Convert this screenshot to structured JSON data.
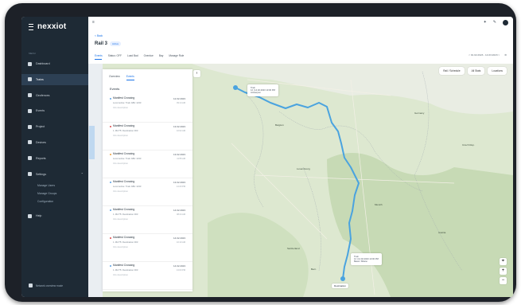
{
  "app": {
    "brand": "nexxiot"
  },
  "sidebar": {
    "section_label": "MENU",
    "items": [
      {
        "label": "Dashboard",
        "icon": "dashboard-icon"
      },
      {
        "label": "Trains",
        "icon": "train-icon"
      },
      {
        "label": "Geofences",
        "icon": "geofence-icon"
      },
      {
        "label": "Events",
        "icon": "events-icon"
      },
      {
        "label": "Project",
        "icon": "project-icon"
      },
      {
        "label": "Devices",
        "icon": "devices-icon"
      },
      {
        "label": "Reports",
        "icon": "reports-icon"
      },
      {
        "label": "Settings",
        "icon": "settings-icon"
      }
    ],
    "sub_items": [
      "Manage Users",
      "Manage Groups",
      "Configuration"
    ],
    "help_label": "Help",
    "footer": "Network overview mode"
  },
  "header": {
    "crumb": "< Back",
    "title": "Rail 3",
    "badge": "Active"
  },
  "filters": {
    "tabs": [
      "Events",
      "Status: OFF",
      "Load Bad",
      "Overdue",
      "Bay",
      "Manage Rule"
    ],
    "right_date_a": "< 01.02.2023 - 14.03.2023 >"
  },
  "map": {
    "controls": [
      "Rail / Schedule",
      "All Stats",
      "Locations"
    ],
    "start_label": "Train\n12 | 14.02.2023 13:00 PM\nAntwerpen",
    "end_label": "Train\n12 | 14.02.2023 13:00 PM\nBasel / Milano",
    "end_marker": "Destination",
    "cities": [
      "Belgium",
      "Germany",
      "Luxembourg",
      "Munich",
      "Czech Rep.",
      "Switzerland",
      "Austria",
      "Bern"
    ]
  },
  "panel": {
    "tabs": [
      "Overview",
      "Events"
    ],
    "heading": "Events",
    "events": [
      {
        "title": "Manifest Crossing",
        "sub": "Locomotive: Train ABC 1233",
        "meta": "Info description",
        "time": "12.02.2023",
        "time_sub": "09:14 AM",
        "dot": "blue"
      },
      {
        "title": "Manifest Crossing",
        "sub": "1 -Bz/75: Destination 003",
        "meta": "Info description",
        "time": "13.02.2023",
        "time_sub": "10:02 AM",
        "dot": "red"
      },
      {
        "title": "Manifest Crossing",
        "sub": "Locomotive: Train ABC 1233",
        "meta": "Info description",
        "time": "13.02.2023",
        "time_sub": "11:55 AM",
        "dot": "orange"
      },
      {
        "title": "Manifest Crossing",
        "sub": "Locomotive: Train ABC 1233",
        "meta": "Info description",
        "time": "13.02.2023",
        "time_sub": "14:20 PM",
        "dot": "blue"
      },
      {
        "title": "Manifest Crossing",
        "sub": "1 -Bz/75: Destination 003",
        "meta": "Info description",
        "time": "14.02.2023",
        "time_sub": "08:44 AM",
        "dot": "blue"
      },
      {
        "title": "Manifest Crossing",
        "sub": "1 -Bz/75: Destination 003",
        "meta": "Info description",
        "time": "14.02.2023",
        "time_sub": "10:10 AM",
        "dot": "red"
      },
      {
        "title": "Manifest Crossing",
        "sub": "1 -Bz/75: Destination 003",
        "meta": "Info description",
        "time": "14.02.2023",
        "time_sub": "13:00 PM",
        "dot": "blue"
      }
    ]
  },
  "colors": {
    "accent": "#1a73e8",
    "sidebar": "#1e2a35",
    "route": "#4aa3df"
  }
}
